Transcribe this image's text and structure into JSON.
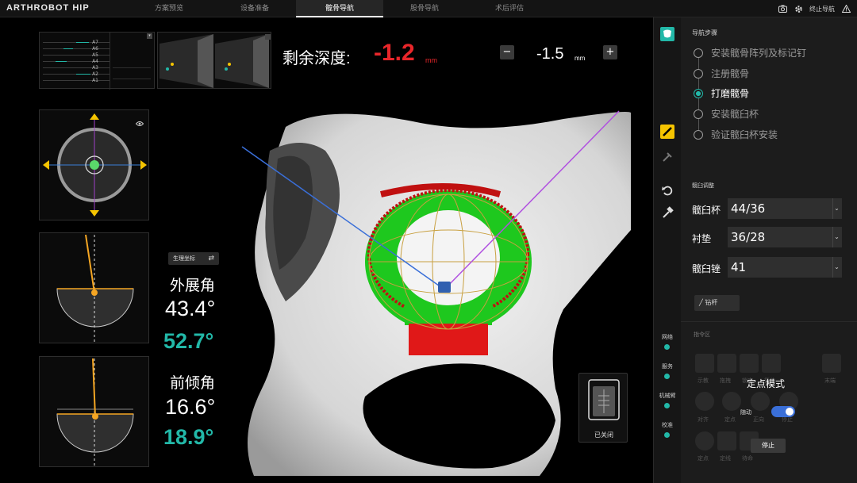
{
  "app": {
    "title": "ARTHROBOT HIP"
  },
  "tabs": [
    {
      "label": "方案预览"
    },
    {
      "label": "设备准备"
    },
    {
      "label": "髋骨导航"
    },
    {
      "label": "股骨导航"
    },
    {
      "label": "术后评估"
    }
  ],
  "topbar": {
    "end_label": "终止导航"
  },
  "tracks": {
    "labels": [
      "A7",
      "A6",
      "A5",
      "A4",
      "A3",
      "A2",
      "A1"
    ]
  },
  "depth": {
    "label": "剩余深度:",
    "value": "-1.2",
    "unit": "mm"
  },
  "target": {
    "value": "-1.5",
    "unit": "mm",
    "minus": "−",
    "plus": "+"
  },
  "coord_toggle": {
    "label": "生理坐标"
  },
  "angles": {
    "abduction": {
      "label": "外展角",
      "current": "43.4°",
      "target": "52.7°"
    },
    "anteversion": {
      "label": "前倾角",
      "current": "16.6°",
      "target": "18.9°"
    }
  },
  "camera_status": {
    "label": "已关闭"
  },
  "nav_steps": {
    "title": "导航步骤",
    "items": [
      {
        "label": "安装髋骨阵列及标记钉",
        "active": false
      },
      {
        "label": "注册髋骨",
        "active": false
      },
      {
        "label": "打磨髋骨",
        "active": true
      },
      {
        "label": "安装髋臼杯",
        "active": false
      },
      {
        "label": "验证髋臼杯安装",
        "active": false
      }
    ]
  },
  "prosthesis": {
    "title": "髋臼调整",
    "cup": {
      "label": "髋臼杯",
      "value": "44/36"
    },
    "liner": {
      "label": "衬垫",
      "value": "36/28"
    },
    "reamer": {
      "label": "髋臼锉",
      "value": "41"
    },
    "drill_button": "钻杆"
  },
  "status": [
    {
      "label": "网络"
    },
    {
      "label": "服务"
    },
    {
      "label": "机械臂"
    },
    {
      "label": "校准"
    }
  ],
  "command_area": {
    "title": "指令区",
    "ghost_row1": [
      "示教",
      "拖拽",
      "锁定",
      "复位",
      "末端"
    ],
    "ghost_row2": [
      "对齐",
      "定点",
      "正向",
      "停止"
    ],
    "ghost_row3": [
      "定点",
      "定线",
      "待命"
    ],
    "mode_title": "定点模式",
    "assist_label": "随动",
    "stop_button": "停止"
  },
  "colors": {
    "accent": "#22b8a8",
    "depth_red": "#e8262a",
    "orange": "#f5a623"
  }
}
